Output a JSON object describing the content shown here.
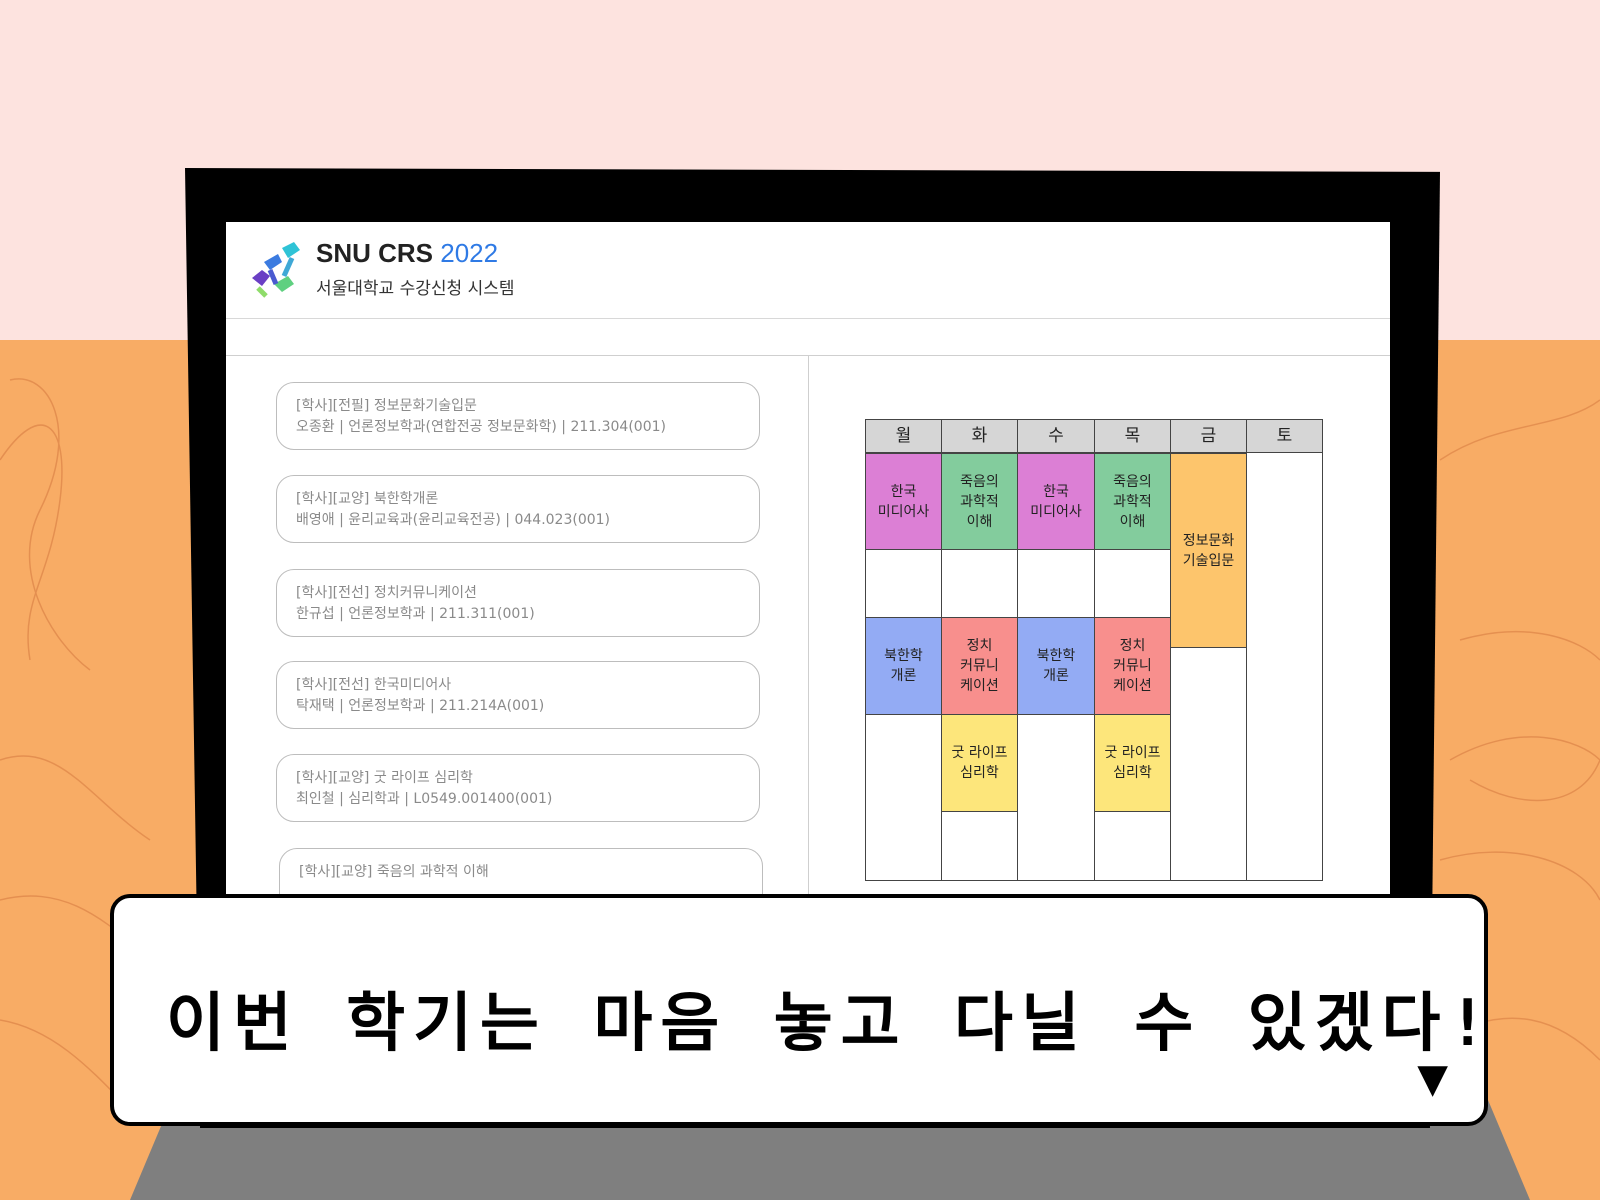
{
  "app": {
    "title_main": "SNU CRS ",
    "title_year": "2022",
    "subtitle": "서울대학교 수강신청 시스템"
  },
  "courses": [
    {
      "line1": "[학사][전필] 정보문화기술입문",
      "line2": "오종환 | 언론정보학과(연합전공 정보문화학) | 211.304(001)"
    },
    {
      "line1": "[학사][교양] 북한학개론",
      "line2": "배영애 | 윤리교육과(윤리교육전공) | 044.023(001)"
    },
    {
      "line1": "[학사][전선] 정치커뮤니케이션",
      "line2": "한규섭 | 언론정보학과 | 211.311(001)"
    },
    {
      "line1": "[학사][전선] 한국미디어사",
      "line2": "탁재택 | 언론정보학과 | 211.214A(001)"
    },
    {
      "line1": "[학사][교양] 굿 라이프 심리학",
      "line2": "최인철 | 심리학과 | L0549.001400(001)"
    },
    {
      "line1": "[학사][교양] 죽음의 과학적 이해",
      "line2": ""
    }
  ],
  "timetable": {
    "days": [
      "월",
      "화",
      "수",
      "목",
      "금",
      "토"
    ],
    "blocks": {
      "mon_media": "한국\n미디어사",
      "tue_death": "죽음의\n과학적\n이해",
      "wed_media": "한국\n미디어사",
      "thu_death": "죽음의\n과학적\n이해",
      "fri_info": "정보문화\n기술입문",
      "mon_nk": "북한학\n개론",
      "tue_pol": "정치\n커뮤니\n케이션",
      "wed_nk": "북한학\n개론",
      "thu_pol": "정치\n커뮤니\n케이션",
      "tue_good": "굿 라이프\n심리학",
      "thu_good": "굿 라이프\n심리학"
    },
    "colors": {
      "media": "#dc7fd5",
      "death": "#83cc9d",
      "info": "#fdc56c",
      "nk": "#93abf4",
      "pol": "#f88f8d",
      "good": "#fde67b"
    }
  },
  "dialog": {
    "text": "이번 학기는 마음 놓고 다닐 수 있겠다!",
    "arrow": "▼"
  }
}
